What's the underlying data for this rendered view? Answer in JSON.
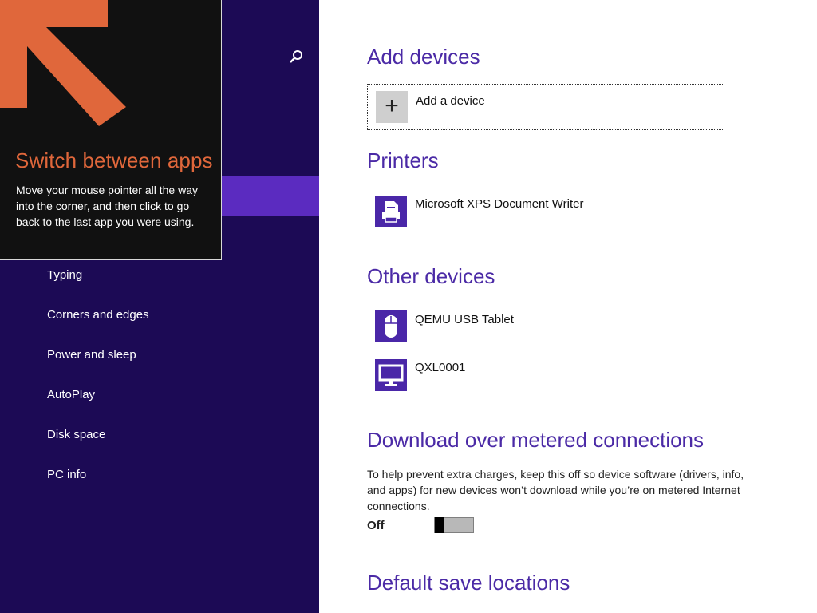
{
  "tip": {
    "title": "Switch between apps",
    "body": "Move your mouse pointer all the way into the corner, and then click to go back to the last app you were using."
  },
  "sidebar": {
    "items": [
      {
        "label": "Typing"
      },
      {
        "label": "Corners and edges"
      },
      {
        "label": "Power and sleep"
      },
      {
        "label": "AutoPlay"
      },
      {
        "label": "Disk space"
      },
      {
        "label": "PC info"
      }
    ]
  },
  "main": {
    "add_devices": {
      "heading": "Add devices",
      "button_label": "Add a device",
      "button_icon": "+"
    },
    "printers": {
      "heading": "Printers",
      "items": [
        {
          "label": "Microsoft XPS Document Writer",
          "icon": "printer-icon"
        }
      ]
    },
    "other_devices": {
      "heading": "Other devices",
      "items": [
        {
          "label": "QEMU USB Tablet",
          "icon": "mouse-icon"
        },
        {
          "label": "QXL0001",
          "icon": "monitor-icon"
        }
      ]
    },
    "metered": {
      "heading": "Download over metered connections",
      "description": "To help prevent extra charges, keep this off so device software (drivers, info, and apps) for new devices won’t download while you’re on metered Internet connections.",
      "toggle_state": "Off"
    },
    "save_locations": {
      "heading": "Default save locations"
    }
  },
  "colors": {
    "sidebar_bg": "#1c0a55",
    "sidebar_selected": "#5b2bc0",
    "heading": "#4b2aa6",
    "tip_accent": "#e0673b"
  }
}
